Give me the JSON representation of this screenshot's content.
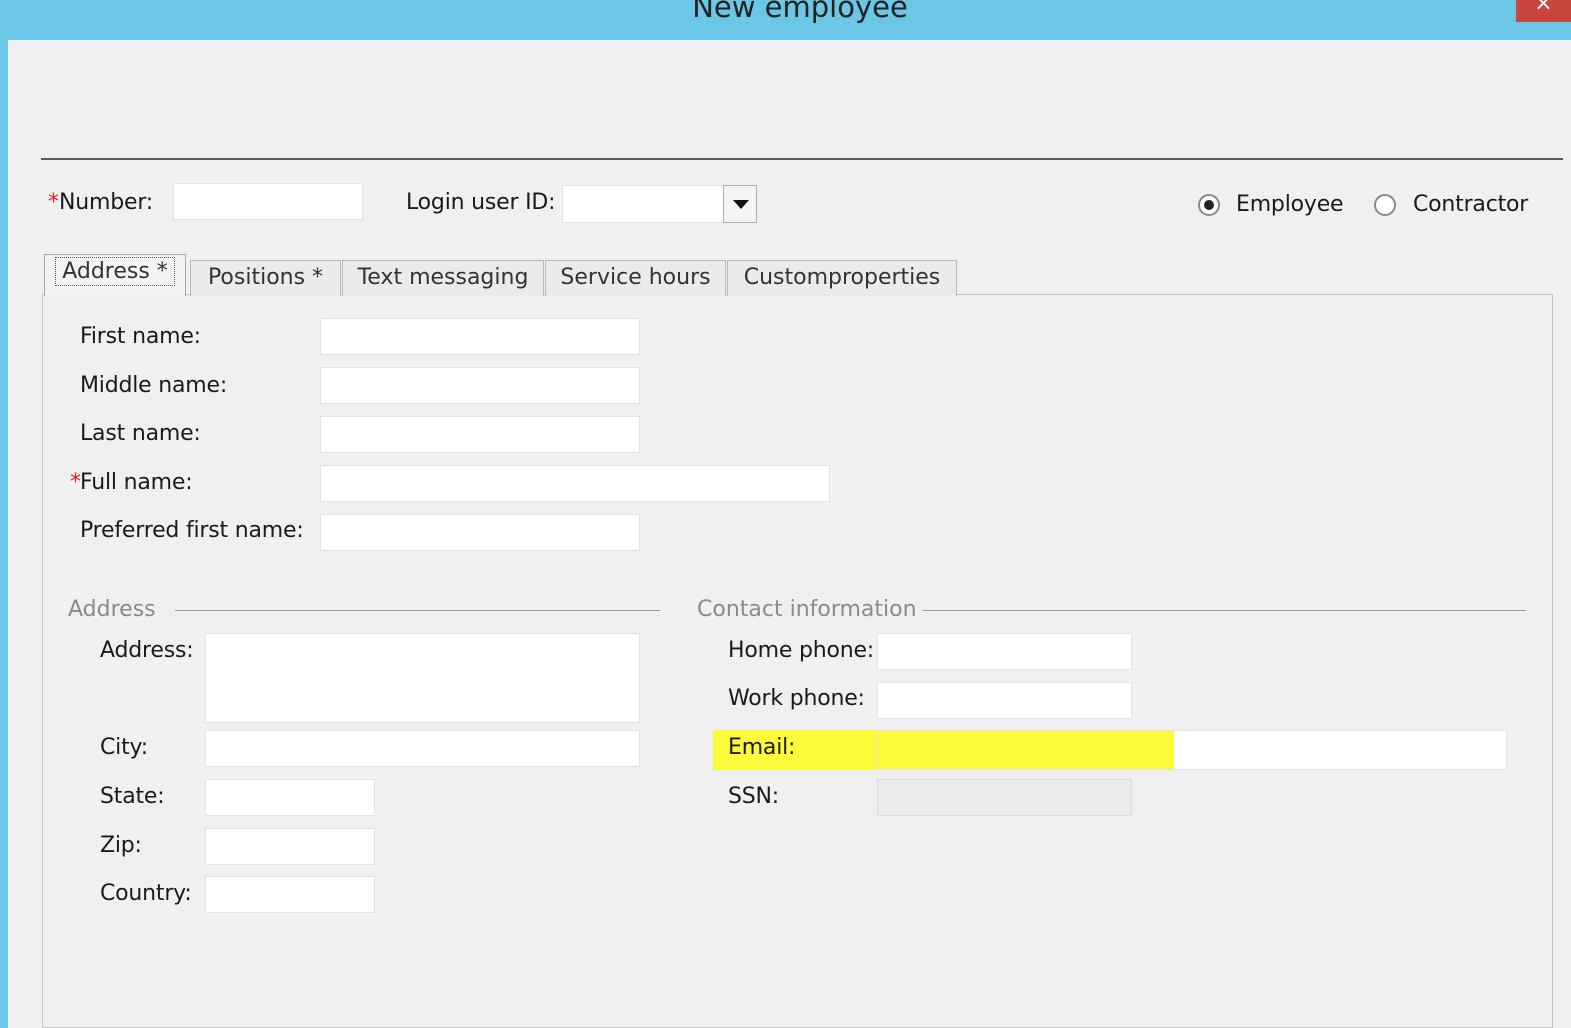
{
  "window": {
    "title": "New employee",
    "close_icon": "close-icon",
    "close_glyph": "×"
  },
  "header": {
    "number_label": "Number:",
    "required_mark": "*",
    "number_value": "",
    "login_label": "Login user ID:",
    "login_value": "",
    "radio_employee": "Employee",
    "radio_contractor": "Contractor",
    "selected_type": "Employee"
  },
  "tabs": [
    {
      "label": "Address *",
      "active": true
    },
    {
      "label": "Positions *",
      "active": false
    },
    {
      "label": "Text messaging",
      "active": false
    },
    {
      "label": "Service hours",
      "active": false
    },
    {
      "label": "Customproperties",
      "active": false
    }
  ],
  "name_fields": {
    "first_name": "First name:",
    "middle_name": "Middle name:",
    "last_name": "Last name:",
    "full_name": "Full name:",
    "preferred_first_name": "Preferred first name:"
  },
  "address_group": {
    "title": "Address",
    "address": "Address:",
    "city": "City:",
    "state": "State:",
    "zip": "Zip:",
    "country": "Country:"
  },
  "contact_group": {
    "title": "Contact information",
    "home_phone": "Home phone:",
    "work_phone": "Work phone:",
    "email": "Email:",
    "ssn": "SSN:"
  },
  "colors": {
    "titlebar": "#6cc7e6",
    "close_button": "#c7453e",
    "highlight": "#fbfb3a",
    "required": "#dd2222"
  }
}
